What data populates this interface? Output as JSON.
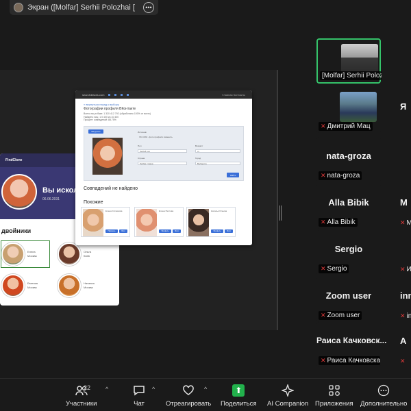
{
  "share_bar": {
    "title": "Экран ([Molfar] Serhii Polozhai [",
    "more_icon": "ellipsis-icon"
  },
  "back_app": {
    "logo": "FindClone",
    "nav": "Войти",
    "hero_title": "Вы исколи",
    "hero_date": "06.06.2031",
    "section": "двойники",
    "twins": [
      {
        "name": "Елена",
        "sub": "Москва"
      },
      {
        "name": "Ольга",
        "sub": "Киев"
      },
      {
        "name": "Евгения",
        "sub": "Москва"
      },
      {
        "name": "Наталия",
        "sub": "Москва"
      }
    ]
  },
  "front_app": {
    "brand": "search4faces.com",
    "right": "Главная   Контакты",
    "crumb": "« вернуться назад к выбору",
    "heading": "Фотографии профиля ВКонтакте",
    "info": "Всего лиц в базе: 1 320 412 792 (обработано 100% от всего)\nНайдено лиц: 1 0 400 из 10 400\nПроцент совпадений: 88.75%",
    "upload": "Загрузить",
    "search": "Найти",
    "fields": [
      {
        "label": "Источник",
        "value": "VK.COM - фото профиля  изменить"
      },
      {
        "label": "Пол",
        "value": "Любой пол"
      },
      {
        "label": "Страна",
        "value": "Любая страна"
      },
      {
        "label": "Возраст",
        "value": "от"
      },
      {
        "label": "Город",
        "value": "Выберите"
      }
    ],
    "no_results": "Совпадений не найдено",
    "similar": "Похожие",
    "cards": [
      {
        "name": "Елена Ситникова",
        "buttons": [
          "Профиль",
          "Фото"
        ]
      },
      {
        "name": "Елена Пестова",
        "buttons": [
          "Профиль",
          "Фото"
        ]
      },
      {
        "name": "Наталья Ильина",
        "buttons": [
          "Профиль",
          "Фото"
        ]
      }
    ]
  },
  "gallery": {
    "tiles": [
      {
        "name": "[Molfar] Serhii Polozhai [S",
        "active": true,
        "video": true
      },
      {
        "name": "Дмитрий Мац",
        "video": true
      },
      {
        "big": "nata-groza",
        "name": "nata-groza"
      },
      {
        "big": "Alla Bibik",
        "name": "Alla Bibik"
      },
      {
        "big": "Sergio",
        "name": "Sergio"
      },
      {
        "big": "Zoom user",
        "name": "Zoom user"
      },
      {
        "big": "Раиса  Качковск...",
        "name": "Раиса Качковская"
      }
    ],
    "side": [
      {
        "big": "",
        "name": ""
      },
      {
        "big": "Я",
        "name": ""
      },
      {
        "big": "",
        "name": ""
      },
      {
        "big": "М",
        "name": "М"
      },
      {
        "big": "",
        "name": "Ин"
      },
      {
        "big": "inn",
        "name": "inn"
      },
      {
        "big": "А",
        "name": ""
      }
    ],
    "muted_icon": "muted-mic-icon"
  },
  "toolbar": {
    "participants": "Участники",
    "participants_count": "22",
    "chat": "Чат",
    "react": "Отреагировать",
    "share": "Поделиться",
    "ai": "AI Companion",
    "apps": "Приложения",
    "more": "Дополнительно"
  },
  "colors": {
    "active_border": "#35c36a",
    "share_green": "#22b14c",
    "muted_red": "#e03a3a",
    "background": "#1a1a1a"
  }
}
